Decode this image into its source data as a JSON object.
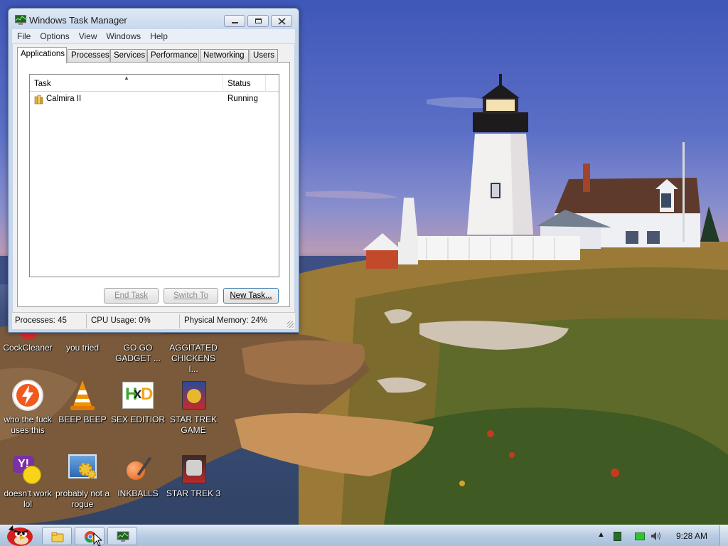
{
  "window": {
    "title": "Windows Task Manager",
    "menu": [
      "File",
      "Options",
      "View",
      "Windows",
      "Help"
    ],
    "tabs": [
      "Applications",
      "Processes",
      "Services",
      "Performance",
      "Networking",
      "Users"
    ],
    "active_tab": "Applications",
    "columns": {
      "task": "Task",
      "status": "Status"
    },
    "rows": [
      {
        "task": "Calmira II",
        "status": "Running"
      }
    ],
    "buttons": {
      "end_task": "End Task",
      "switch_to": "Switch To",
      "new_task": "New Task..."
    },
    "status": {
      "processes": "Processes: 45",
      "cpu": "CPU Usage: 0%",
      "memory": "Physical Memory: 24%"
    }
  },
  "desktop_icons": [
    {
      "label": "CockCleaner",
      "icon": "cleaner-icon"
    },
    {
      "label": "you tried",
      "icon": "app-icon"
    },
    {
      "label": "GO GO GADGET ...",
      "icon": "app-icon"
    },
    {
      "label": "AGGITATED CHICKENS I...",
      "icon": "game-icon"
    },
    {
      "label": "who the fuck uses this",
      "icon": "winamp-icon"
    },
    {
      "label": "BEEP BEEP",
      "icon": "vlc-cone-icon"
    },
    {
      "label": "SEX EDITIOR",
      "icon": "hxd-icon"
    },
    {
      "label": "STAR TREK GAME",
      "icon": "star-wars-game-icon"
    },
    {
      "label": "doesn't work lol",
      "icon": "yahoo-messenger-icon"
    },
    {
      "label": "probably not a rogue",
      "icon": "settings-gears-icon"
    },
    {
      "label": "INKBALLS",
      "icon": "inkball-icon"
    },
    {
      "label": "STAR TREK 3",
      "icon": "star-wars-game-icon"
    }
  ],
  "taskbar": {
    "start": "angry-bird-start-icon",
    "buttons": [
      "folder-icon",
      "chrome-icon",
      "task-manager-icon"
    ],
    "clock": "9:28 AM"
  },
  "colors": {
    "accent": "#3c7fb1",
    "window_frame": "#c6d6ec",
    "taskbar": "#b9cce3"
  }
}
